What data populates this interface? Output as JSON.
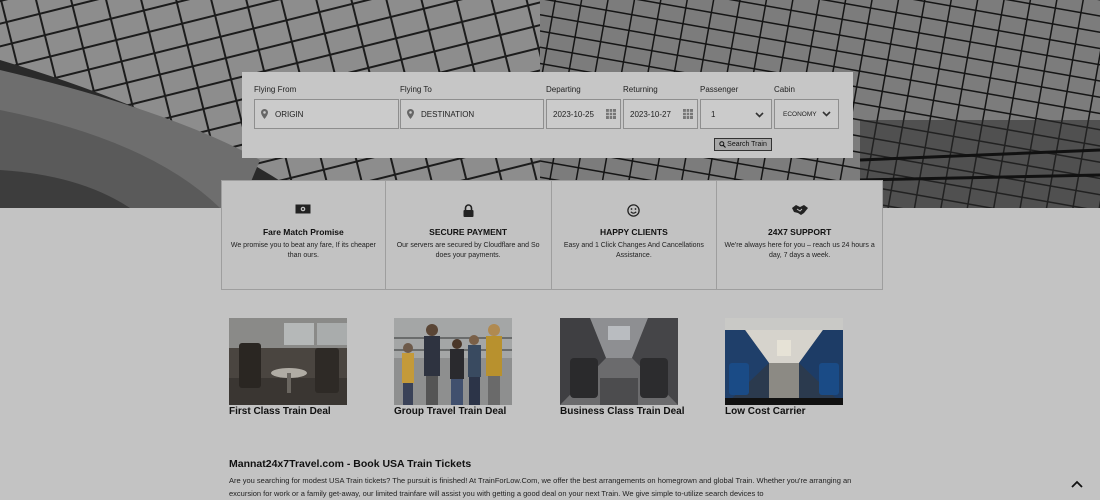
{
  "search": {
    "from_label": "Flying From",
    "from_placeholder": "ORIGIN",
    "to_label": "Flying To",
    "to_placeholder": "DESTINATION",
    "departing_label": "Departing",
    "departing_value": "2023-10-25",
    "returning_label": "Returning",
    "returning_value": "2023-10-27",
    "passenger_label": "Passenger",
    "passenger_value": "1",
    "cabin_label": "Cabin",
    "cabin_value": "ECONOMY",
    "button_label": "Search Train"
  },
  "features": [
    {
      "icon": "money-icon",
      "title": "Fare Match Promise",
      "text": "We promise you to beat any fare, If its cheaper than ours."
    },
    {
      "icon": "lock-icon",
      "title": "SECURE PAYMENT",
      "text": "Our servers are secured by Cloudflare and So does your payments."
    },
    {
      "icon": "smiley-icon",
      "title": "HAPPY CLIENTS",
      "text": "Easy and 1 Click Changes And Cancellations Assistance."
    },
    {
      "icon": "handshake-icon",
      "title": "24X7 SUPPORT",
      "text": "We're always here for you – reach us 24 hours a day, 7 days a week."
    }
  ],
  "deals": [
    {
      "title": "First Class Train Deal"
    },
    {
      "title": "Group Travel Train Deal"
    },
    {
      "title": "Business Class Train Deal"
    },
    {
      "title": "Low Cost Carrier"
    }
  ],
  "about": {
    "title": "Mannat24x7Travel.com - Book USA Train Tickets",
    "text": "Are you searching for modest USA Train tickets? The pursuit is finished! At TrainForLow.Com, we offer the best arrangements on homegrown and global Train. Whether you're arranging an excursion for work or a family get-away, our limited trainfare will assist you with getting a good deal on your next Train. We give simple to-utilize search devices to"
  },
  "colors": {
    "overlay": "#c3c3c3",
    "accent_dark": "#333333"
  }
}
